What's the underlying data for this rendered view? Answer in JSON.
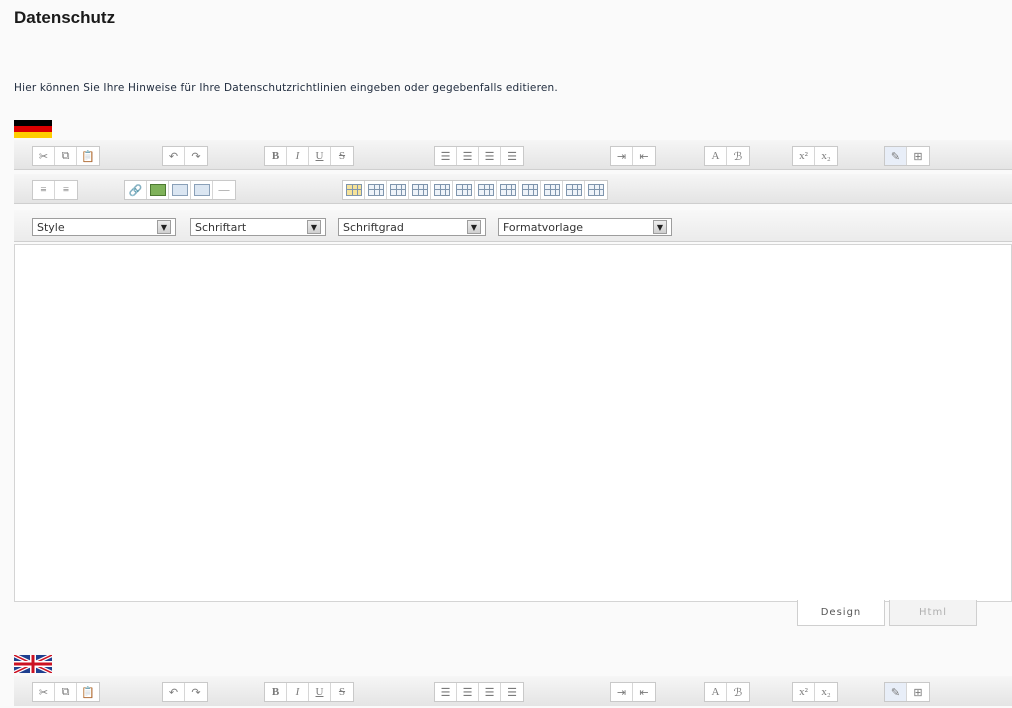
{
  "page": {
    "title": "Datenschutz",
    "intro": "Hier können Sie Ihre Hinweise für Ihre Datenschutzrichtlinien eingeben oder gegebenfalls editieren."
  },
  "toolbar_row1": {
    "groups": [
      {
        "buttons": [
          "cut-icon",
          "copy-icon",
          "paste-icon"
        ]
      },
      {
        "buttons": [
          "undo-icon",
          "redo-icon"
        ]
      },
      {
        "buttons": [
          "bold-icon",
          "italic-icon",
          "underline-icon",
          "strikethrough-icon"
        ]
      },
      {
        "buttons": [
          "align-left-icon",
          "align-center-icon",
          "align-right-icon",
          "justify-icon"
        ]
      },
      {
        "buttons": [
          "indent-icon",
          "outdent-icon"
        ]
      },
      {
        "buttons": [
          "font-color-icon",
          "highlight-icon"
        ]
      },
      {
        "buttons": [
          "superscript-icon",
          "subscript-icon"
        ]
      },
      {
        "buttons": [
          "edit-source-icon",
          "table-grid-icon"
        ]
      }
    ],
    "glyphs": {
      "bold": "B",
      "italic": "I",
      "underline": "U",
      "strikethrough": "S",
      "superscript": "x²",
      "subscript": "x₂"
    }
  },
  "formatting": {
    "style": "Style",
    "font": "Schriftart",
    "size": "Schriftgrad",
    "template": "Formatvorlage"
  },
  "editor": {
    "design_tab": "Design",
    "html_tab": "Html"
  },
  "languages": [
    "german-flag-icon",
    "uk-flag-icon"
  ],
  "colors": {
    "toolbar_bg": "#ececec",
    "flag_de": [
      "#000000",
      "#dd0000",
      "#ffce00"
    ],
    "flag_uk_blue": "#1f3f8f"
  }
}
